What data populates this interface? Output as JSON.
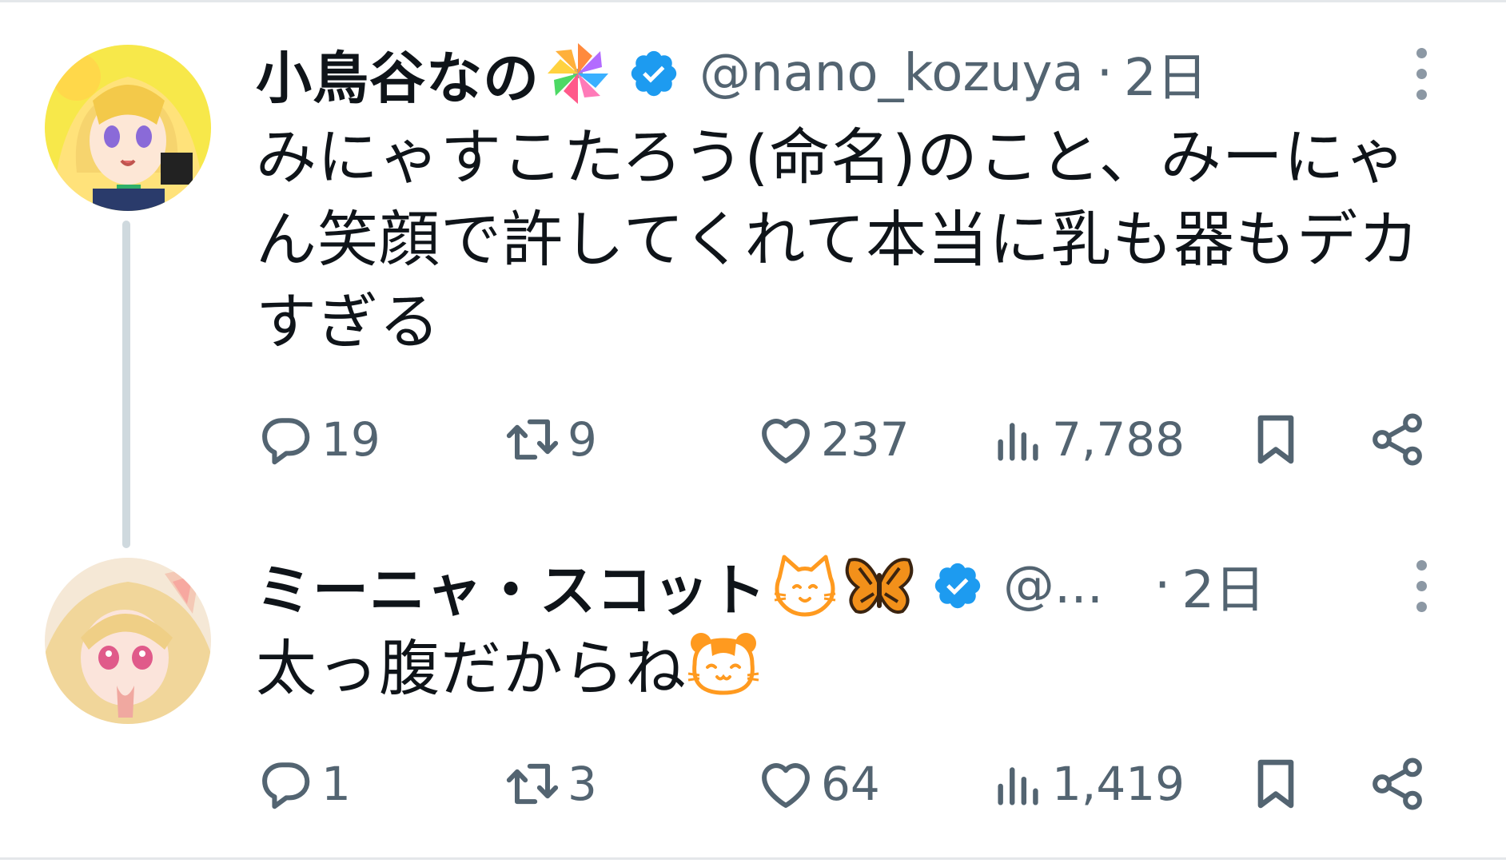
{
  "tweets": [
    {
      "author": {
        "display_name": "小鳥谷なの",
        "name_emojis": [
          "pinwheel-emoji"
        ],
        "verified": true,
        "handle": "@nano_kozuya"
      },
      "separator": "·",
      "time": "2日",
      "text_lines": [
        "みにゃすこたろう(命名)のこと、みーにゃ",
        "ん笑顔で許してくれて本当に乳も器もデカ",
        "すぎる"
      ],
      "stats": {
        "replies": "19",
        "reposts": "9",
        "likes": "237",
        "views": "7,788"
      }
    },
    {
      "author": {
        "display_name": "ミーニャ・スコット",
        "name_emojis": [
          "cat-face-emoji",
          "butterfly-emoji"
        ],
        "verified": true,
        "handle": "@..."
      },
      "separator": "·",
      "time": "2日",
      "text": "太っ腹だからね",
      "text_emoji": "hamster-emoji",
      "stats": {
        "replies": "1",
        "reposts": "3",
        "likes": "64",
        "views": "1,419"
      }
    }
  ],
  "colors": {
    "text_primary": "#0f1419",
    "text_secondary": "#536471",
    "verified_blue": "#1d9bf0",
    "thread_line": "#cfd9de",
    "emoji_orange": "#ff9a1f"
  }
}
